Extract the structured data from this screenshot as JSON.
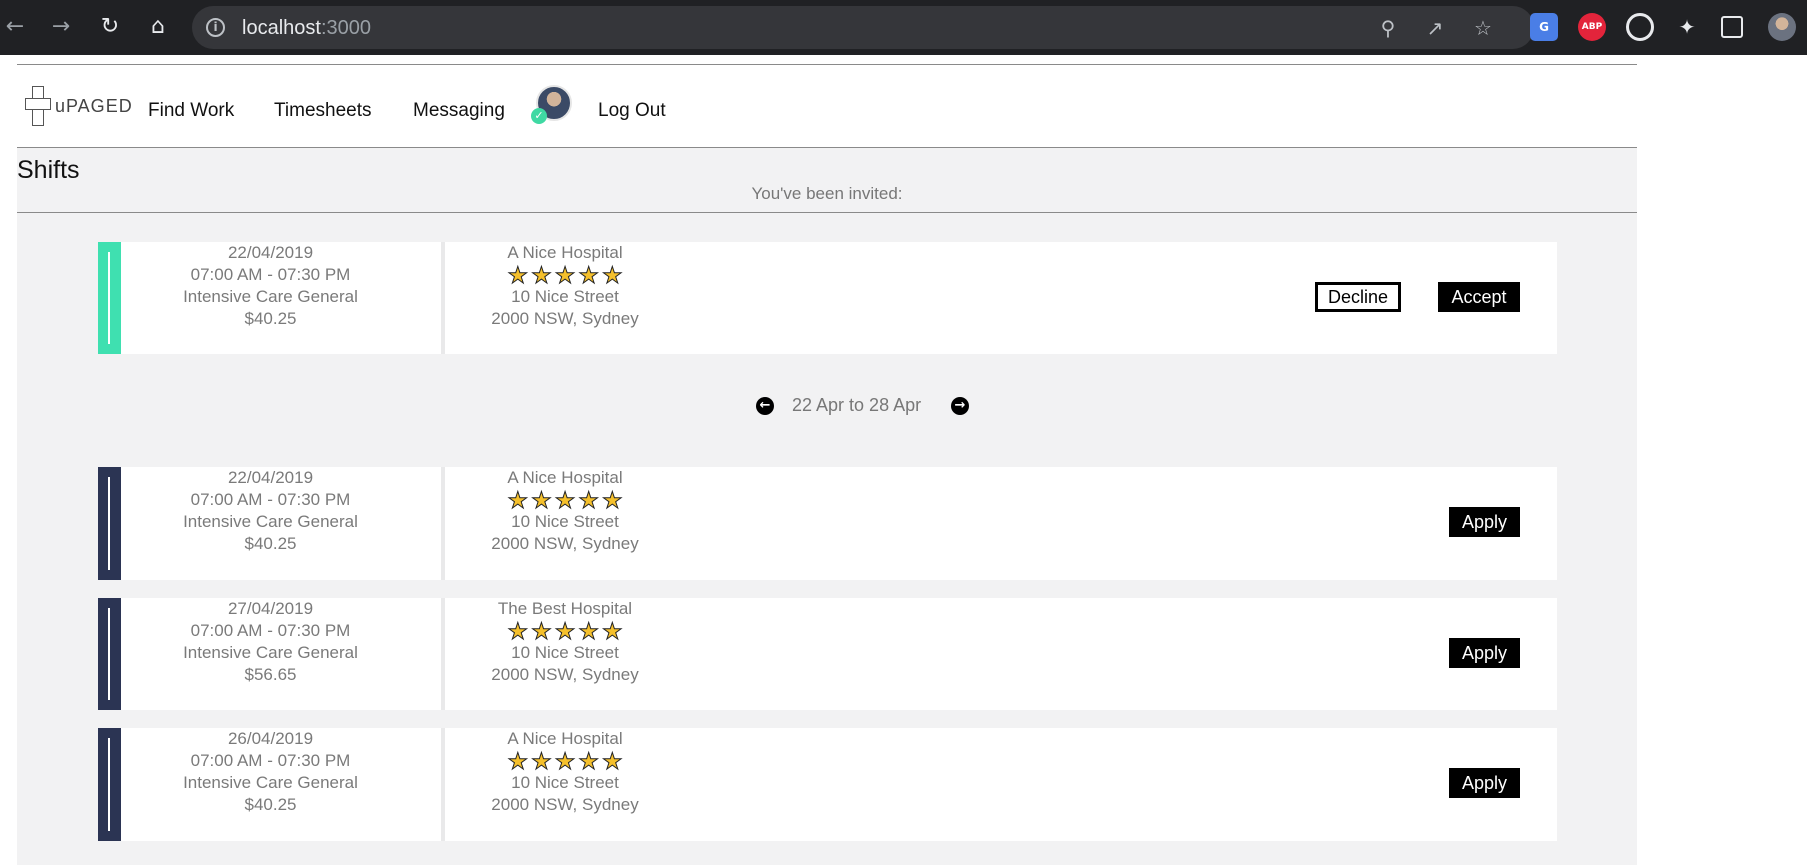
{
  "browser": {
    "url_host": "localhost",
    "url_port": ":3000",
    "nav_icons": [
      "back-arrow-icon",
      "forward-arrow-icon",
      "reload-icon",
      "home-icon"
    ],
    "extensions": [
      {
        "name": "google-translate-icon",
        "label": "G",
        "color": "#4a7ee6"
      },
      {
        "name": "adblock-plus-icon",
        "label": "ABP",
        "color": "#e3243b"
      }
    ]
  },
  "header": {
    "brand": "uPAGED",
    "nav": {
      "find_work": "Find Work",
      "timesheets": "Timesheets",
      "messaging": "Messaging",
      "log_out": "Log Out"
    }
  },
  "shifts": {
    "title": "Shifts",
    "invited_label": "You've been invited:",
    "invited": [
      {
        "date": "22/04/2019",
        "time": "07:00 AM - 07:30 PM",
        "department": "Intensive Care General",
        "rate": "$40.25",
        "hospital": "A Nice Hospital",
        "rating": 5,
        "street": "10 Nice Street",
        "city": "2000 NSW, Sydney",
        "decline_label": "Decline",
        "accept_label": "Accept",
        "strip_color": "#3fe0b0"
      }
    ],
    "week": {
      "label": "22 Apr to 28 Apr"
    },
    "available": [
      {
        "date": "22/04/2019",
        "time": "07:00 AM - 07:30 PM",
        "department": "Intensive Care General",
        "rate": "$40.25",
        "hospital": "A Nice Hospital",
        "rating": 5,
        "street": "10 Nice Street",
        "city": "2000 NSW, Sydney",
        "apply_label": "Apply",
        "strip_color": "#2b3453"
      },
      {
        "date": "27/04/2019",
        "time": "07:00 AM - 07:30 PM",
        "department": "Intensive Care General",
        "rate": "$56.65",
        "hospital": "The Best Hospital",
        "rating": 5,
        "street": "10 Nice Street",
        "city": "2000 NSW, Sydney",
        "apply_label": "Apply",
        "strip_color": "#2b3453"
      },
      {
        "date": "26/04/2019",
        "time": "07:00 AM - 07:30 PM",
        "department": "Intensive Care General",
        "rate": "$40.25",
        "hospital": "A Nice Hospital",
        "rating": 5,
        "street": "10 Nice Street",
        "city": "2000 NSW, Sydney",
        "apply_label": "Apply",
        "strip_color": "#2b3453"
      }
    ]
  }
}
